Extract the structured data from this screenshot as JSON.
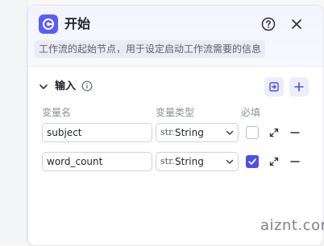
{
  "node": {
    "title": "开始",
    "icon": "start-node-icon",
    "description": "工作流的起始节点，用于设定启动工作流需要的信息",
    "header_actions": {
      "help_icon": "question-circle-icon",
      "close_icon": "close-icon"
    }
  },
  "inputs_section": {
    "title": "输入",
    "info_icon": "info-circle-icon",
    "import_icon": "import-icon",
    "add_icon": "plus-icon",
    "columns": {
      "name": "变量名",
      "type": "变量类型",
      "required": "必填"
    },
    "rows": [
      {
        "name": "subject",
        "type_glyph": "str.",
        "type": "String",
        "required": false
      },
      {
        "name": "word_count",
        "type_glyph": "str.",
        "type": "String",
        "required": true
      }
    ]
  },
  "watermark": "aiznt.com",
  "colors": {
    "accent": "#4c4ff0",
    "icon_bg": "#5b5ef4",
    "header_bg": "#f3f4ff"
  }
}
